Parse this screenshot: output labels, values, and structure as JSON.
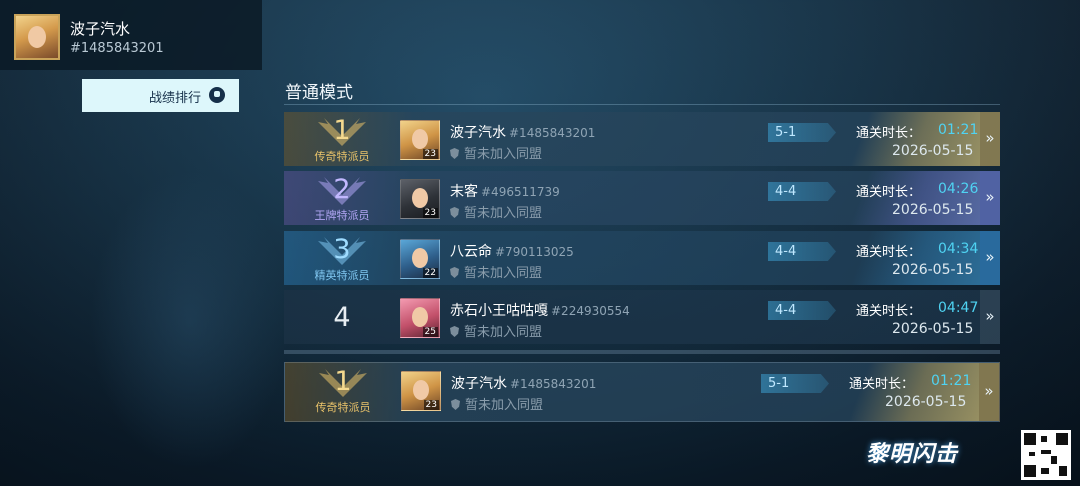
{
  "player": {
    "name": "波子汽水",
    "id": "#1485843201"
  },
  "nav": {
    "ranking_tab": "战绩排行"
  },
  "mode": {
    "title": "普通模式"
  },
  "rows": [
    {
      "rank": "1",
      "rank_title": "传奇特派员",
      "name": "波子汽水",
      "id": "#1485843201",
      "level": "23",
      "alliance": "暂未加入同盟",
      "stage": "5-1",
      "clear_label": "通关时长：",
      "clear_time": "01:21",
      "date": "2026-05-15"
    },
    {
      "rank": "2",
      "rank_title": "王牌特派员",
      "name": "末客",
      "id": "#496511739",
      "level": "23",
      "alliance": "暂未加入同盟",
      "stage": "4-4",
      "clear_label": "通关时长：",
      "clear_time": "04:26",
      "date": "2026-05-15"
    },
    {
      "rank": "3",
      "rank_title": "精英特派员",
      "name": "八云命",
      "id": "#790113025",
      "level": "22",
      "alliance": "暂未加入同盟",
      "stage": "4-4",
      "clear_label": "通关时长：",
      "clear_time": "04:34",
      "date": "2026-05-15"
    },
    {
      "rank": "4",
      "rank_title": "",
      "name": "赤石小王咕咕嘎",
      "id": "#224930554",
      "level": "25",
      "alliance": "暂未加入同盟",
      "stage": "4-4",
      "clear_label": "通关时长：",
      "clear_time": "04:47",
      "date": "2026-05-15"
    }
  ],
  "my_row": {
    "rank": "1",
    "rank_title": "传奇特派员",
    "name": "波子汽水",
    "id": "#1485843201",
    "level": "23",
    "alliance": "暂未加入同盟",
    "stage": "5-1",
    "clear_label": "通关时长：",
    "clear_time": "01:21",
    "date": "2026-05-15"
  },
  "expand_glyph": "»",
  "brand": {
    "logo_text": "黎明闪击"
  },
  "colors": {
    "accent_time": "#4fd3f2",
    "tab_bg": "#ddf7fb",
    "gold": "#e8c26a",
    "purple": "#b0a6f4",
    "blue": "#7fc6f0"
  }
}
